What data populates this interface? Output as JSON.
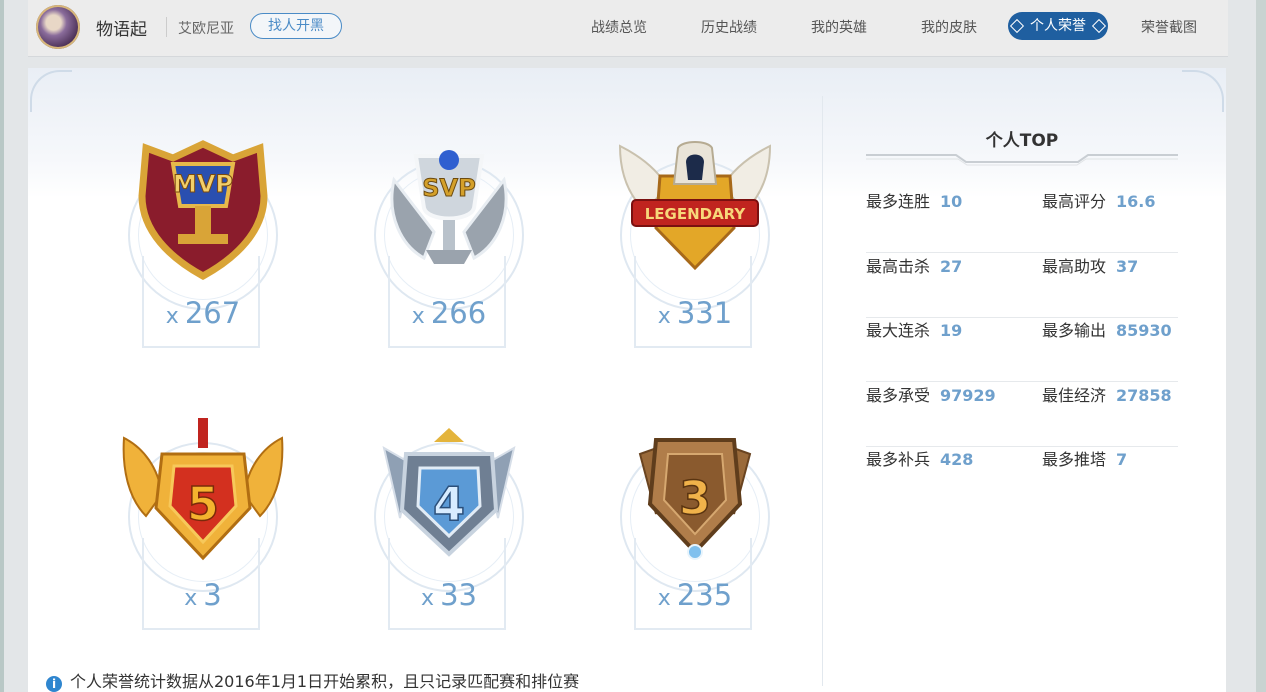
{
  "header": {
    "player_name": "物语起",
    "server_name": "艾欧尼亚",
    "find_button": "找人开黑"
  },
  "nav": {
    "items": [
      "战绩总览",
      "历史战绩",
      "我的英雄",
      "我的皮肤",
      "个人荣誉",
      "荣誉截图"
    ],
    "active": "个人荣誉"
  },
  "badges": [
    {
      "label": "MVP",
      "icon": "mvp-badge-icon",
      "prefix": "x",
      "count": "267"
    },
    {
      "label": "SVP",
      "icon": "svp-badge-icon",
      "prefix": "x",
      "count": "266"
    },
    {
      "label": "LEGENDARY",
      "icon": "legendary-badge-icon",
      "prefix": "x",
      "count": "331"
    },
    {
      "label": "5",
      "icon": "penta-kill-badge-icon",
      "prefix": "x",
      "count": "3"
    },
    {
      "label": "4",
      "icon": "quadra-kill-badge-icon",
      "prefix": "x",
      "count": "33"
    },
    {
      "label": "3",
      "icon": "triple-kill-badge-icon",
      "prefix": "x",
      "count": "235"
    }
  ],
  "personal_top": {
    "title": "个人TOP",
    "stats": [
      {
        "label": "最多连胜",
        "value": "10"
      },
      {
        "label": "最高评分",
        "value": "16.6"
      },
      {
        "label": "最高击杀",
        "value": "27"
      },
      {
        "label": "最高助攻",
        "value": "37"
      },
      {
        "label": "最大连杀",
        "value": "19"
      },
      {
        "label": "最多输出",
        "value": "85930"
      },
      {
        "label": "最多承受",
        "value": "97929"
      },
      {
        "label": "最佳经济",
        "value": "27858"
      },
      {
        "label": "最多补兵",
        "value": "428"
      },
      {
        "label": "最多推塔",
        "value": "7"
      }
    ]
  },
  "footnote": "个人荣誉统计数据从2016年1月1日开始累积，且只记录匹配赛和排位赛",
  "colors": {
    "accent": "#1f5fa0",
    "value_blue": "#6fa0cc",
    "gold": "#d4a02a"
  }
}
